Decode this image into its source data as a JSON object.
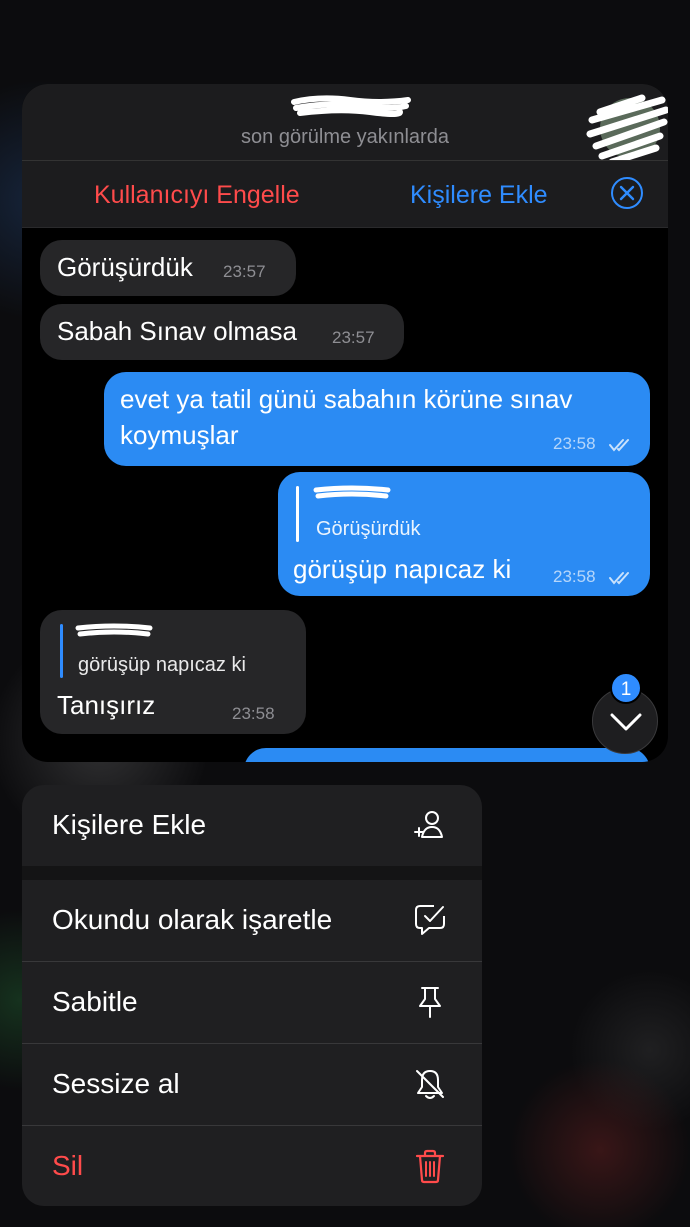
{
  "header": {
    "last_seen": "son görülme yakınlarda"
  },
  "actions": {
    "block": "Kullanıcıyı Engelle",
    "add_contact": "Kişilere Ekle"
  },
  "messages": [
    {
      "type": "in",
      "text": "Görüşürdük",
      "time": "23:57"
    },
    {
      "type": "in",
      "text": "Sabah Sınav olmasa",
      "time": "23:57"
    },
    {
      "type": "out",
      "lines": [
        "evet ya tatil günü sabahın körüne sınav",
        "koymuşlar"
      ],
      "time": "23:58",
      "read": true
    },
    {
      "type": "out",
      "reply_quote": "Görüşürdük",
      "text": "görüşüp napıcaz ki",
      "time": "23:58",
      "read": true
    },
    {
      "type": "in",
      "reply_quote": "görüşüp napıcaz ki",
      "text": "Tanışırız",
      "time": "23:58"
    }
  ],
  "unread_badge": "1",
  "menu": {
    "items": [
      {
        "label": "Kişilere Ekle",
        "icon": "add-contact-icon"
      },
      {
        "label": "Okundu olarak işaretle",
        "icon": "mark-read-icon"
      },
      {
        "label": "Sabitle",
        "icon": "pin-icon"
      },
      {
        "label": "Sessize al",
        "icon": "mute-icon"
      },
      {
        "label": "Sil",
        "icon": "trash-icon",
        "destructive": true
      }
    ]
  },
  "colors": {
    "accent": "#2f8cff",
    "destructive": "#ff4b4b",
    "outgoing_bubble": "#2b8bf3",
    "incoming_bubble": "#262628"
  }
}
